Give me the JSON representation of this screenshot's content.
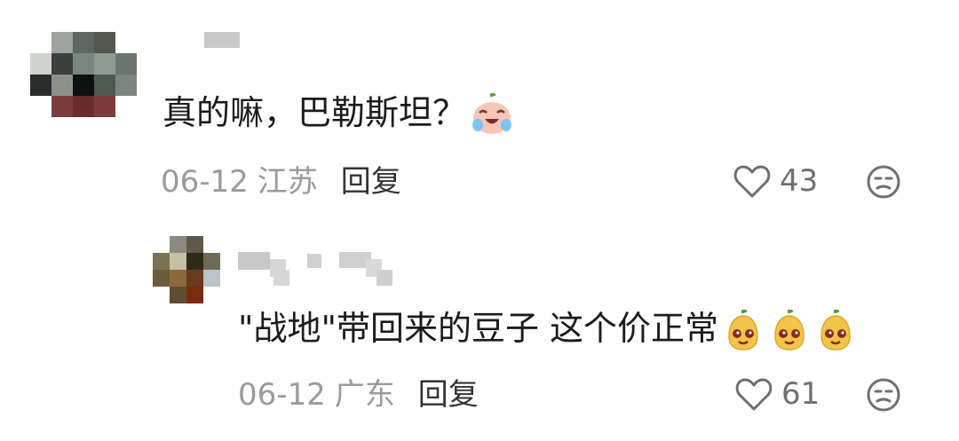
{
  "comments": [
    {
      "text": "真的嘛，巴勒斯坦？",
      "emoji_icon": "crying-laughing-face-icon",
      "date": "06-12",
      "location": "江苏",
      "reply_label": "回复",
      "like_count": "43"
    },
    {
      "text": "\"战地\"带回来的豆子 这个价正常",
      "emoji_icon": "bean-face-icon",
      "emoji_repeat": 3,
      "date": "06-12",
      "location": "广东",
      "reply_label": "回复",
      "like_count": "61"
    }
  ],
  "icons": {
    "like": "heart-outline-icon",
    "dislike": "meh-face-icon"
  },
  "colors": {
    "text": "#1b1b1b",
    "meta": "#9a9a9a",
    "reply": "#333333",
    "icon": "#6f6f6f"
  }
}
